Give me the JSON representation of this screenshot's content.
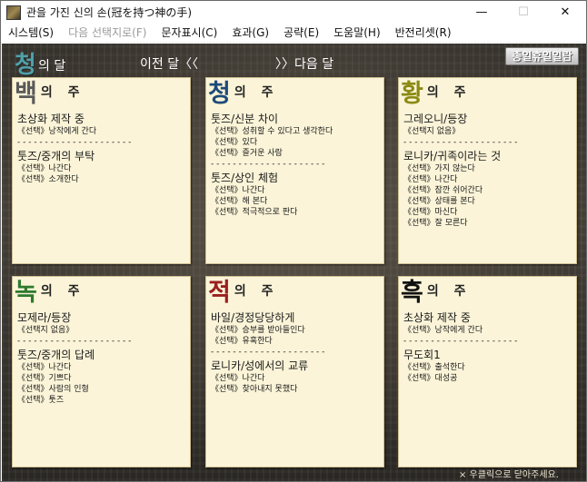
{
  "window": {
    "title": "관을 가진 신의 손(冠を持つ神の手)",
    "minimize_glyph": "—",
    "maximize_glyph": "☐",
    "close_glyph": "✕"
  },
  "menu": [
    {
      "label": "시스템(S)",
      "enabled": true
    },
    {
      "label": "다음 선택지로(F)",
      "enabled": false
    },
    {
      "label": "문자표시(C)",
      "enabled": true
    },
    {
      "label": "효과(G)",
      "enabled": true
    },
    {
      "label": "공략(E)",
      "enabled": true
    },
    {
      "label": "도움말(H)",
      "enabled": true
    },
    {
      "label": "반전리셋(R)",
      "enabled": true
    }
  ],
  "calendar": {
    "month_char": "청",
    "month_suffix": "의 달",
    "prev_label": "이전 달〈〈",
    "next_label": "〉〉다음 달",
    "holiday_button": "종일휴일일람"
  },
  "colors": {
    "white": "#5a5a5a",
    "blue": "#1d4a7a",
    "yellow": "#8a8a12",
    "green": "#2e7a2e",
    "red": "#9a2020",
    "black": "#111111"
  },
  "panels": [
    {
      "char": "백",
      "suffix": "의 주",
      "color_key": "white",
      "sections": [
        {
          "event": "초상화 제작 중",
          "options": [
            "《선택》낭작에게 간다"
          ]
        },
        {
          "event": "툿즈/중개의 부탁",
          "options": [
            "《선택》나간다",
            "《선택》소개한다"
          ]
        }
      ]
    },
    {
      "char": "청",
      "suffix": "의 주",
      "color_key": "blue",
      "sections": [
        {
          "event": "툿즈/신분 차이",
          "options": [
            "《선택》성취할 수 있다고 생각한다",
            "《선택》있다",
            "《선택》즐거운 사람"
          ]
        },
        {
          "event": "툿즈/상인 체험",
          "options": [
            "《선택》나간다",
            "《선택》해 본다",
            "《선택》적극적으로 판다"
          ]
        }
      ]
    },
    {
      "char": "황",
      "suffix": "의 주",
      "color_key": "yellow",
      "sections": [
        {
          "event": "그레오니/등장",
          "options": [
            "《선택지 없음》"
          ]
        },
        {
          "event": "로니카/귀족이라는 것",
          "options": [
            "《선택》가지 않는다",
            "《선택》나간다",
            "《선택》잠깐 쉬어간다",
            "《선택》상태를 본다",
            "《선택》마신다",
            "《선택》잘 모른다"
          ]
        }
      ]
    },
    {
      "char": "녹",
      "suffix": "의 주",
      "color_key": "green",
      "sections": [
        {
          "event": "모제라/등장",
          "options": [
            "《선택지 없음》"
          ]
        },
        {
          "event": "툿즈/중개의 답례",
          "options": [
            "《선택》나간다",
            "《선택》기쁘다",
            "《선택》사람의 인형",
            "《선택》툿즈"
          ]
        }
      ]
    },
    {
      "char": "적",
      "suffix": "의 주",
      "color_key": "red",
      "sections": [
        {
          "event": "바일/경정당당하게",
          "options": [
            "《선택》승부를 받아들인다",
            "《선택》유혹한다"
          ]
        },
        {
          "event": "로니카/성에서의 교류",
          "options": [
            "《선택》나간다",
            "《선택》찾아내지 못했다"
          ]
        }
      ]
    },
    {
      "char": "흑",
      "suffix": "의 주",
      "color_key": "black",
      "sections": [
        {
          "event": "초상화 제작 중",
          "options": [
            "《선택》낭작에게 간다"
          ]
        },
        {
          "event": "무도회1",
          "options": [
            "《선택》출석한다",
            "《선택》대성공"
          ]
        }
      ]
    }
  ],
  "separator": "- - - - - - - - - - - - - - - - - - - - -",
  "footer": "× 우클릭으로 닫아주세요."
}
